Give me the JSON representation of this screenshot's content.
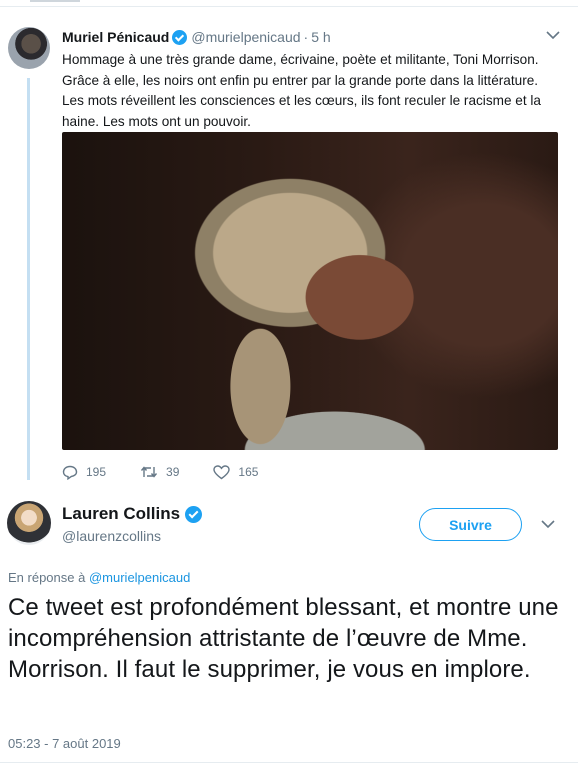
{
  "tweet1": {
    "author_name": "Muriel Pénicaud",
    "handle": "@murielpenicaud",
    "separator": "·",
    "time": "5 h",
    "text": "Hommage à une très grande dame, écrivaine, poète et militante, Toni Morrison. Grâce à elle, les noirs ont enfin pu entrer par la grande porte dans la littérature. Les mots réveillent les consciences et les cœurs, ils font reculer le racisme et la haine. Les mots ont un pouvoir.",
    "replies": "195",
    "retweets": "39",
    "likes": "165",
    "icons": [
      "verified-badge-icon",
      "chevron-down-icon",
      "reply-icon",
      "retweet-icon",
      "like-icon"
    ]
  },
  "tweet2": {
    "author_name": "Lauren Collins",
    "handle": "@laurenzcollins",
    "follow_label": "Suivre",
    "reply_prefix": "En réponse à",
    "reply_mention": "@murielpenicaud",
    "text": "Ce tweet est profondément blessant, et montre une incompréhension attristante de l’œuvre de Mme. Morrison. Il faut le supprimer, je vous en implore.",
    "timestamp": "05:23 - 7 août 2019"
  },
  "colors": {
    "accent": "#1da1f2",
    "muted_text": "#657786",
    "thread_line": "#c4dff2",
    "text": "#14171a"
  }
}
